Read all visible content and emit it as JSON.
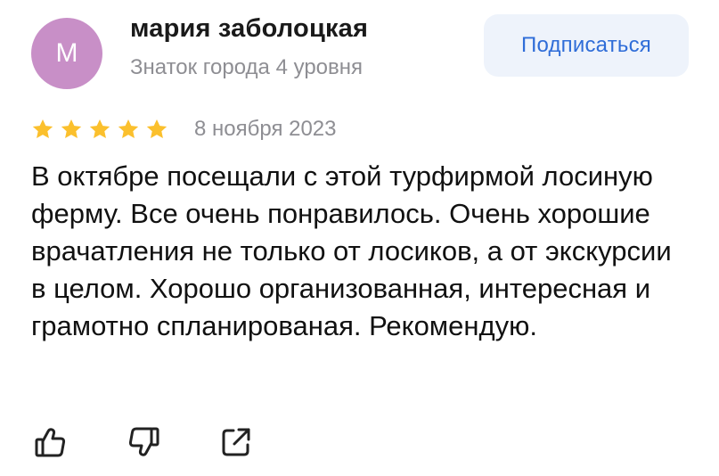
{
  "author": {
    "initial": "М",
    "name": "мария заболоцкая",
    "level": "Знаток города 4 уровня"
  },
  "subscribe_label": "Подписаться",
  "review": {
    "rating": 5,
    "rating_max": 5,
    "date": "8 ноября 2023",
    "text": "В октябре посещали с этой турфирмой лосиную ферму. Все очень понравилось. Очень хорошие врачатления не только от лосиков, а от экскурсии в целом. Хорошо организованная, интересная и грамотно спланированая. Рекомендую."
  },
  "actions": [
    "thumbs-up-icon",
    "thumbs-down-icon",
    "share-icon"
  ],
  "colors": {
    "avatar": "#c88fc7",
    "star": "#fbc02d",
    "accent": "#2f6dd8",
    "button_bg": "#eef3fb",
    "muted": "#8e8e93"
  }
}
